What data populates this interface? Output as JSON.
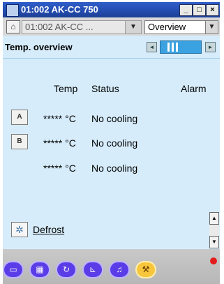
{
  "window": {
    "title": "01:002 AK-CC 750",
    "minimize": "_",
    "maximize": "□",
    "close": "×"
  },
  "toolbar": {
    "device_select": "01:002 AK-CC ...",
    "view_select": "Overview"
  },
  "page": {
    "title": "Temp. overview"
  },
  "columns": {
    "temp": "Temp",
    "status": "Status",
    "alarm": "Alarm"
  },
  "rows": [
    {
      "badge": "A",
      "temp": "***** °C",
      "status": "No cooling"
    },
    {
      "badge": "B",
      "temp": "***** °C",
      "status": "No cooling"
    },
    {
      "badge": "",
      "temp": "***** °C",
      "status": "No cooling"
    }
  ],
  "defrost": {
    "label": "Defrost"
  },
  "bottom_nav": [
    "display-icon",
    "grid-icon",
    "tools-icon",
    "chart-icon",
    "bell-icon",
    "wrench-icon"
  ],
  "colors": {
    "content_bg": "#d6ecfb",
    "titlebar": "#2650b5",
    "bottom_icon": "#5a3de6",
    "bottom_icon_active": "#f7c63c",
    "alarm": "#e41b1b"
  }
}
